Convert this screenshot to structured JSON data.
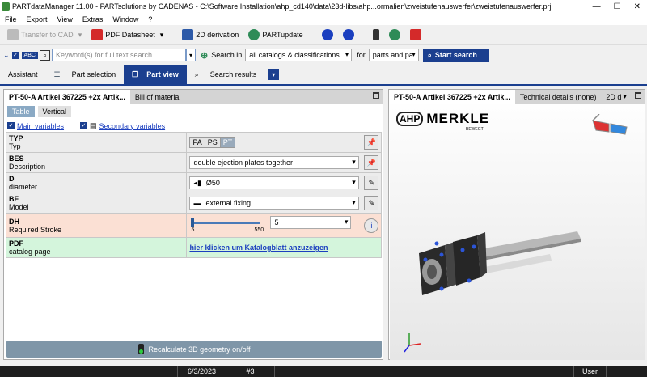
{
  "window": {
    "title": "PARTdataManager 11.00 - PARTsolutions by CADENAS - C:\\Software Installation\\ahp_cd140\\data\\23d-libs\\ahp...ormalien\\zweistufenauswerfer\\zweistufenauswerfer.prj"
  },
  "menu": {
    "items": [
      "File",
      "Export",
      "View",
      "Extras",
      "Window",
      "?"
    ]
  },
  "toolbar": {
    "transfer_label": "Transfer to CAD",
    "datasheet_label": "PDF Datasheet",
    "derivation_label": "2D derivation",
    "update_label": "PARTupdate"
  },
  "search": {
    "abc": "ABC",
    "placeholder": "Keyword(s) for full text search",
    "search_in_label": "Search in",
    "catalogs_value": "all catalogs & classifications",
    "for_label": "for",
    "parts_value": "parts and pa",
    "start_label": "Start search"
  },
  "navtabs": {
    "assistant": "Assistant",
    "part_selection": "Part selection",
    "part_view": "Part view",
    "search_results": "Search results"
  },
  "left": {
    "tab_title": "PT-50-A Artikel 367225 +2x Artik...",
    "tab_bom": "Bill of material",
    "subtab_table": "Table",
    "subtab_vertical": "Vertical",
    "main_variables": "Main variables",
    "secondary_variables": "Secondary variables",
    "rows": [
      {
        "name": "TYP",
        "desc": "Typ"
      },
      {
        "name": "BES",
        "desc": "Description",
        "value": "double ejection plates together"
      },
      {
        "name": "D",
        "desc": "diameter",
        "value": "Ø50"
      },
      {
        "name": "BF",
        "desc": "Model",
        "value": "external fixing"
      },
      {
        "name": "DH",
        "desc": "Required Stroke",
        "value": "5",
        "min": "5",
        "max": "550"
      },
      {
        "name": "PDF",
        "desc": "catalog page",
        "value": "hier klicken um Katalogblatt anzuzeigen"
      }
    ],
    "typ_options": [
      "PA",
      "PS",
      "PT"
    ],
    "recalc_label": "Recalculate 3D geometry on/off"
  },
  "right": {
    "tab_title": "PT-50-A Artikel 367225 +2x Artik...",
    "tab_tech": "Technical details (none)",
    "tab_2d": "2D d",
    "brand_name": "MERKLE",
    "brand_logo": "AHP",
    "brand_tagline": "BEWEGT"
  },
  "status": {
    "date": "6/3/2023",
    "num": "#3",
    "user": "User"
  },
  "colors": {
    "accent": "#1b3f8f",
    "row_pink": "#fbe0d4",
    "row_green": "#d4f5dc",
    "recalc": "#7f96a8"
  }
}
